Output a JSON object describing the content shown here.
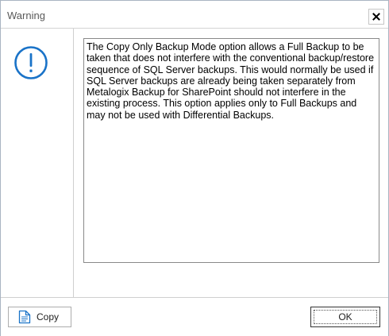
{
  "window": {
    "title": "Warning",
    "close_icon": "close-icon"
  },
  "left_panel": {
    "icon": "warning-exclamation-icon",
    "icon_color": "#1a73c8"
  },
  "message": {
    "text": "The Copy Only Backup Mode option allows a Full Backup to be taken that does not interfere with the conventional backup/restore sequence of SQL Server backups. This would normally be used if SQL Server backups are already being taken separately from Metalogix Backup for SharePoint should not interfere in the existing process. This option applies only to Full Backups and may not be used with Differential Backups."
  },
  "buttons": {
    "copy_label": "Copy",
    "copy_icon": "copy-document-icon",
    "ok_label": "OK"
  }
}
